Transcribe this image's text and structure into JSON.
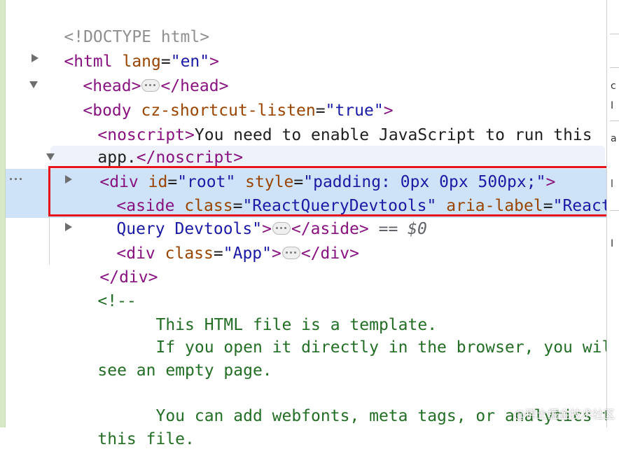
{
  "lines": {
    "doctype": "<!DOCTYPE html>",
    "html_open": {
      "tag_open": "<html ",
      "attr": "lang",
      "eq": "=",
      "val": "\"en\"",
      "close": ">"
    },
    "head": {
      "open": "<head>",
      "close": "</head>"
    },
    "body_open": {
      "tag_open": "<body ",
      "attr": "cz-shortcut-listen",
      "eq": "=",
      "val": "\"true\"",
      "close": ">"
    },
    "noscript": {
      "open": "<noscript>",
      "text": "You need to enable JavaScript to run this",
      "text2": "app.",
      "close": "</noscript>"
    },
    "div_root": {
      "tag_open": "<div ",
      "attr1": "id",
      "eq1": "=",
      "val1": "\"root\"",
      "space": " ",
      "attr2": "style",
      "eq2": "=",
      "val2": "\"padding: 0px 0px 500px;\"",
      "close": ">"
    },
    "aside": {
      "tag_open": "<aside ",
      "attr1": "class",
      "eq1": "=",
      "val1": "\"ReactQueryDevtools\"",
      "space": " ",
      "attr2": "aria-label",
      "eq2": "=",
      "val2a": "\"React",
      "val2b": "Query Devtools\"",
      "close": ">",
      "end": "</aside>",
      "eqeq": " == ",
      "dollar": "$0"
    },
    "div_app": {
      "tag_open": "<div ",
      "attr": "class",
      "eq": "=",
      "val": "\"App\"",
      "close": ">",
      "end": "</div>"
    },
    "div_close": "</div>",
    "comment": {
      "open": "<!--",
      "l1": "      This HTML file is a template.",
      "l2": "      If you open it directly in the browser, you will",
      "l3": "see an empty page.",
      "l4": "      You can add webfonts, meta tags, or analytics to",
      "l5": "this file."
    }
  },
  "right_panel_chars": [
    "c",
    "I",
    "a",
    "l",
    "I"
  ],
  "watermark": "@稀土掘金技术社区",
  "colors": {
    "tag": "#881280",
    "attr": "#994500",
    "value": "#1a1aa6",
    "comment": "#236e25",
    "selected_bg": "#cfe3f8",
    "highlight_border": "#e8141b"
  }
}
